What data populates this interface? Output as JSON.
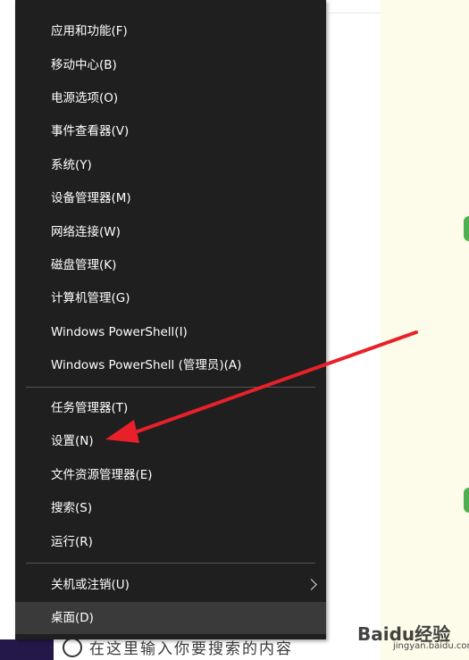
{
  "menu": {
    "items": [
      {
        "label": "应用和功能(F)"
      },
      {
        "label": "移动中心(B)"
      },
      {
        "label": "电源选项(O)"
      },
      {
        "label": "事件查看器(V)"
      },
      {
        "label": "系统(Y)"
      },
      {
        "label": "设备管理器(M)"
      },
      {
        "label": "网络连接(W)"
      },
      {
        "label": "磁盘管理(K)"
      },
      {
        "label": "计算机管理(G)"
      },
      {
        "label": "Windows PowerShell(I)"
      },
      {
        "label": "Windows PowerShell (管理员)(A)"
      },
      {
        "label": "任务管理器(T)"
      },
      {
        "label": "设置(N)"
      },
      {
        "label": "文件资源管理器(E)"
      },
      {
        "label": "搜索(S)"
      },
      {
        "label": "运行(R)"
      },
      {
        "label": "关机或注销(U)"
      },
      {
        "label": "桌面(D)"
      }
    ],
    "submenu_icon": "chevron-right-icon"
  },
  "annotation": {
    "color": "#e8202a",
    "points_to": "设置(N)"
  },
  "background": {
    "bottom_text": "在这里输入你要搜索的内容",
    "watermark": "Baidu经验",
    "watermark_sub": "jingyan.baidu.com"
  },
  "colors": {
    "menu_bg": "#1f1f1f",
    "hover_bg": "#3a3a3a",
    "text": "#ffffff",
    "accent_green": "#4caf50"
  }
}
